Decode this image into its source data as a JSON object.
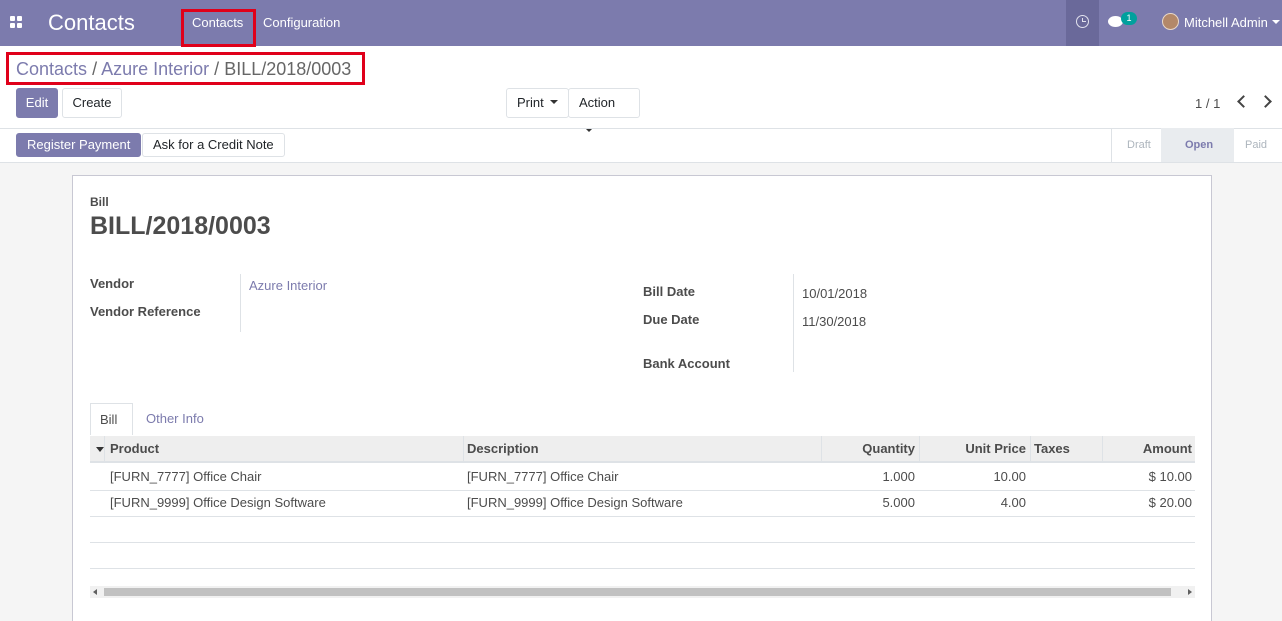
{
  "navbar": {
    "app_title": "Contacts",
    "menu": [
      "Contacts",
      "Configuration"
    ],
    "notification_count": "1",
    "user_name": "Mitchell Admin",
    "icons": {
      "apps": "apps-grid-icon",
      "activity": "clock-icon",
      "messages": "chat-icon",
      "user": "avatar-icon"
    }
  },
  "breadcrumb": {
    "items": [
      "Contacts",
      "Azure Interior",
      "BILL/2018/0003"
    ],
    "separator": "/"
  },
  "control_panel": {
    "edit": "Edit",
    "create": "Create",
    "print": "Print",
    "action": "Action",
    "pager": "1 / 1"
  },
  "statusbar": {
    "register_payment": "Register Payment",
    "credit_note": "Ask for a Credit Note",
    "stages": [
      "Draft",
      "Open",
      "Paid"
    ],
    "active_stage": "Open"
  },
  "form": {
    "type_label": "Bill",
    "number": "BILL/2018/0003",
    "vendor_label": "Vendor",
    "vendor_value": "Azure Interior",
    "vendor_ref_label": "Vendor Reference",
    "bill_date_label": "Bill Date",
    "bill_date_value": "10/01/2018",
    "due_date_label": "Due Date",
    "due_date_value": "11/30/2018",
    "bank_account_label": "Bank Account"
  },
  "tabs": [
    "Bill",
    "Other Info"
  ],
  "lines": {
    "columns": [
      "Product",
      "Description",
      "Quantity",
      "Unit Price",
      "Taxes",
      "Amount"
    ],
    "rows": [
      {
        "product": "[FURN_7777] Office Chair",
        "description": "[FURN_7777] Office Chair",
        "quantity": "1.000",
        "unit_price": "10.00",
        "taxes": "",
        "amount": "$ 10.00"
      },
      {
        "product": "[FURN_9999] Office Design Software",
        "description": "[FURN_9999] Office Design Software",
        "quantity": "5.000",
        "unit_price": "4.00",
        "taxes": "",
        "amount": "$ 20.00"
      }
    ]
  },
  "colors": {
    "brand": "#7c7bad",
    "highlight": "#e0001a",
    "badge": "#00a09d"
  }
}
